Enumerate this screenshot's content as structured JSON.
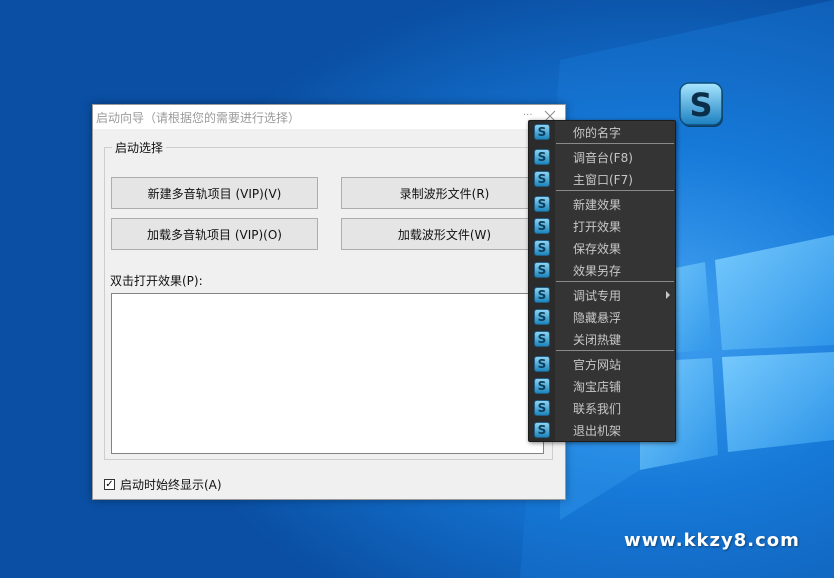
{
  "dialog": {
    "title": "启动向导（请根据您的需要进行选择）",
    "title_dots": "...",
    "group_label": "启动选择",
    "buttons": {
      "new_multitrack": "新建多音轨项目 (VIP)(V)",
      "record_wave": "录制波形文件(R)",
      "load_multitrack": "加载多音轨项目 (VIP)(O)",
      "load_wave": "加载波形文件(W)"
    },
    "list_label": "双击打开效果(P):",
    "checkbox": {
      "label": "启动时始终显示(A)",
      "checked": true,
      "mark": "✓"
    }
  },
  "menu": {
    "icon_letter": "S",
    "items": [
      {
        "label": "你的名字"
      },
      {
        "label": "调音台(F8)"
      },
      {
        "label": "主窗口(F7)"
      },
      {
        "label": "新建效果"
      },
      {
        "label": "打开效果"
      },
      {
        "label": "保存效果"
      },
      {
        "label": "效果另存"
      },
      {
        "label": "调试专用",
        "submenu": true
      },
      {
        "label": "隐藏悬浮"
      },
      {
        "label": "关闭热键"
      },
      {
        "label": "官方网站"
      },
      {
        "label": "淘宝店铺"
      },
      {
        "label": "联系我们"
      },
      {
        "label": "退出机架"
      }
    ]
  },
  "floating_icon": {
    "letter": "S"
  },
  "watermark": "www.kkzy8.com"
}
